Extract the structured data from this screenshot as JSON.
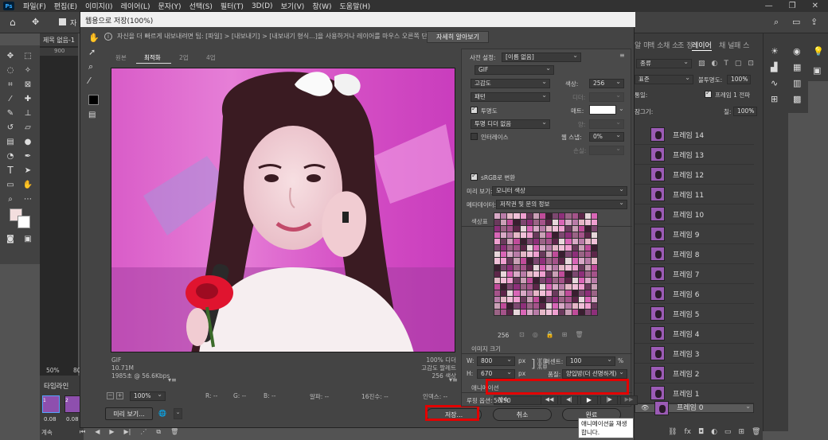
{
  "menubar": {
    "items": [
      "파일(F)",
      "편집(E)",
      "이미지(I)",
      "레이어(L)",
      "문자(Y)",
      "선택(S)",
      "필터(T)",
      "3D(D)",
      "보기(V)",
      "창(W)",
      "도움말(H)"
    ]
  },
  "optbar": {
    "checkbox_label": "자"
  },
  "doc": {
    "tab": "제목 없음-1",
    "ruler": "900",
    "zoom": "50%",
    "extra": "80"
  },
  "timeline": {
    "title": "타임라인",
    "frame1_time": "0.08",
    "frame2_time": "0.08",
    "loop_label": "계속"
  },
  "layers": {
    "tabs": [
      "알 마",
      "액 소",
      "채 소",
      "조 정",
      "레이어",
      "채 널",
      "패 스"
    ],
    "kind_filter": "종류",
    "blend_mode": "표준",
    "opacity_label": "불투명도:",
    "opacity_value": "100%",
    "unify_label": "통일:",
    "propagate_label": "프레임 1 전파",
    "lock_label": "잠그기:",
    "fill_label": "칠:",
    "fill_value": "100%",
    "items": [
      "프레임 14",
      "프레임 13",
      "프레임 12",
      "프레임 11",
      "프레임 10",
      "프레임 9",
      "프레임 8",
      "프레임 7",
      "프레임 6",
      "프레임 5",
      "프레임 4",
      "프레임 3",
      "프레임 2",
      "프레임 1",
      "프레임 0"
    ]
  },
  "dialog": {
    "title": "웹용으로 저장(100%)",
    "tip": "자신을 더 빠르게 내보내려면 팁: [파일] > [내보내기] > [내보내기 형식...]을 사용하거나 레이어를 마우스 오른쪽 단추로 클릭하면 됩니다.",
    "tip_button": "자세히 알아보기",
    "view_tabs": [
      "원본",
      "최적화",
      "2업",
      "4업"
    ],
    "preview_info_left": [
      "GIF",
      "10.71M",
      "1985초 @ 56.6Kbps"
    ],
    "preview_info_right": [
      "100% 디더",
      "고감도 팔레트",
      "256 색상"
    ],
    "bottom": {
      "zoom": "100%",
      "r": "R: --",
      "g": "G: --",
      "b": "B: --",
      "alpha": "알파: --",
      "hex": "16진수: --",
      "index": "인덱스: --"
    },
    "preview_button": "미리 보기...",
    "save_button": "저장...",
    "cancel_button": "취소",
    "done_button": "완료",
    "tooltip": "애니메이션을 재생합니다."
  },
  "settings": {
    "preset_label": "사전 설정:",
    "preset_value": "[이름 없음]",
    "format": "GIF",
    "reduction": "고감도",
    "colors_label": "색상:",
    "colors_value": "256",
    "dither_algo": "패턴",
    "dither_label": "디더:",
    "transparency_label": "투명도",
    "matte_label": "매트:",
    "trans_dither": "투명 디더 없음",
    "amount_label": "양:",
    "interlace_label": "인터레이스",
    "websnap_label": "웹 스냅:",
    "websnap_value": "0%",
    "lossy_label": "손실:",
    "srgb_label": "sRGB로 변환",
    "preview_label": "미리 보기:",
    "preview_value": "모니터 색상",
    "metadata_label": "메타데이터:",
    "metadata_value": "저작권 및 문의 정보",
    "color_table_title": "색상표",
    "color_count": "256",
    "image_size_title": "이미지 크기",
    "w_label": "W:",
    "w_value": "800",
    "h_label": "H:",
    "h_value": "670",
    "px": "px",
    "percent_label": "퍼센트:",
    "percent_value": "100",
    "percent_unit": "%",
    "quality_label": "품질:",
    "quality_value": "양입방(더 선명하게)",
    "animation_title": "애니메이션",
    "loop_label": "루핑 옵션:",
    "loop_value": "계속",
    "frame_counter": "50/50"
  },
  "palette_colors": [
    "#d8a9c6",
    "#c04c9a",
    "#e7d7db",
    "#6a3a5c",
    "#a5538a",
    "#f0c0d8",
    "#8e2f7a",
    "#b97ca8",
    "#3a1e30",
    "#d966b7",
    "#caa0b6",
    "#5d2649",
    "#ef9fd0",
    "#9b6486",
    "#e5b7c7",
    "#7d4870"
  ]
}
